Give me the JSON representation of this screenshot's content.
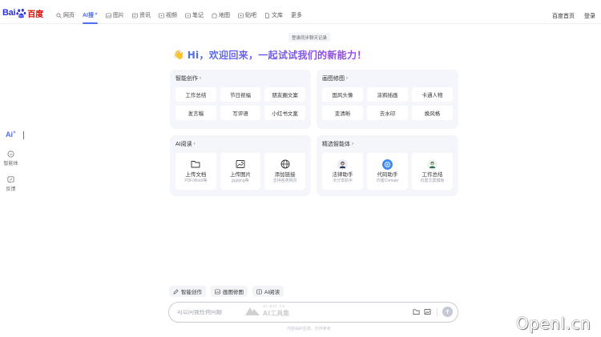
{
  "logo": {
    "bai": "Bai",
    "cn": "百度"
  },
  "nav": {
    "items": [
      {
        "label": "网页",
        "icon": "search-icon"
      },
      {
        "label": "AI搜",
        "icon": "",
        "active": true
      },
      {
        "label": "图片",
        "icon": "image-icon"
      },
      {
        "label": "资讯",
        "icon": "news-icon"
      },
      {
        "label": "视频",
        "icon": "video-icon"
      },
      {
        "label": "笔记",
        "icon": "note-icon"
      },
      {
        "label": "地图",
        "icon": "map-icon"
      },
      {
        "label": "贴吧",
        "icon": "tieba-icon"
      },
      {
        "label": "文库",
        "icon": "doc-icon"
      },
      {
        "label": "更多",
        "icon": ""
      }
    ],
    "right": {
      "home": "百度首页",
      "login": "登录"
    }
  },
  "rail": {
    "ai_badge": "Ai",
    "agent": "智能体",
    "feedback": "反馈"
  },
  "login_hint": "登录同步聊天记录",
  "greeting": {
    "emoji": "👋",
    "title": "Hi，欢迎回来，一起试试我们的新能力！"
  },
  "cards": {
    "creation": {
      "title": "智能创作",
      "chips": [
        "工作总结",
        "节日祝福",
        "朋友圈文案",
        "发言稿",
        "写评语",
        "小红书文案"
      ]
    },
    "drawing": {
      "title": "画图修图",
      "chips": [
        "国风头像",
        "涂鸦插画",
        "卡通人物",
        "变清晰",
        "去水印",
        "换风格"
      ]
    },
    "reading": {
      "title": "AI阅读",
      "tiles": [
        {
          "name": "上传文档",
          "desc": "PDF/Word等",
          "icon": "folder-icon"
        },
        {
          "name": "上传图片",
          "desc": "jpg/png等",
          "icon": "image-upload-icon"
        },
        {
          "name": "添加链接",
          "desc": "支持各类网页",
          "icon": "globe-icon"
        }
      ]
    },
    "agents": {
      "title": "精选智能体",
      "tiles": [
        {
          "name": "法律助手",
          "desc": "法分享助手",
          "icon": "lawyer-avatar-icon"
        },
        {
          "name": "代码助手",
          "desc": "内置Comate",
          "icon": "code-avatar-icon"
        },
        {
          "name": "工作总结",
          "desc": "内置文案模板",
          "icon": "worker-avatar-icon"
        }
      ]
    }
  },
  "modes": [
    {
      "label": "智能创作",
      "icon": "pen-icon"
    },
    {
      "label": "画图修图",
      "icon": "picture-icon"
    },
    {
      "label": "AI阅读",
      "icon": "book-icon"
    }
  ],
  "input": {
    "placeholder": "可以问我任何问题"
  },
  "watermark": {
    "url": "ai-bot.cn",
    "name": "AI工具集"
  },
  "disclaimer": "内容由AI生成，仅供参考",
  "corner_watermark": "OpenI.cn",
  "colors": {
    "accent": "#4e6ef2",
    "purple": "#8a4af2",
    "card_bg": "#f5f6fb"
  }
}
